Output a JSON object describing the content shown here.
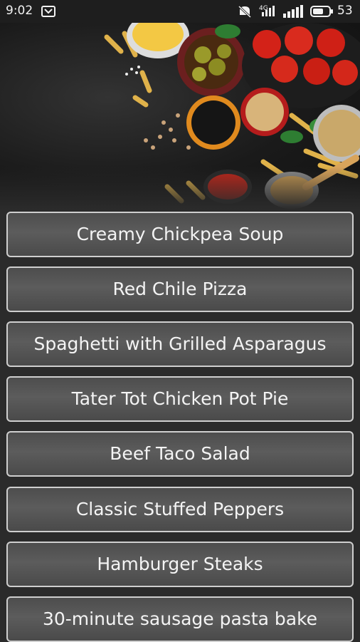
{
  "status_bar": {
    "time": "9:02",
    "battery": "53",
    "icons": [
      "notification-icon",
      "mute-icon",
      "network-icon",
      "signal-bars-icon",
      "battery-icon"
    ]
  },
  "hero": {
    "image": "food-ingredients-banner"
  },
  "recipes": [
    {
      "label": "Creamy Chickpea Soup"
    },
    {
      "label": "Red Chile Pizza"
    },
    {
      "label": "Spaghetti with Grilled Asparagus"
    },
    {
      "label": "Tater Tot Chicken Pot Pie"
    },
    {
      "label": "Beef Taco Salad"
    },
    {
      "label": "Classic Stuffed Peppers"
    },
    {
      "label": "Hamburger Steaks"
    },
    {
      "label": "30-minute sausage pasta bake"
    }
  ],
  "colors": {
    "button_border": "#cfcfcf",
    "button_fill": "#555555",
    "background": "#2b2b2b",
    "text": "#f4f4f4"
  }
}
